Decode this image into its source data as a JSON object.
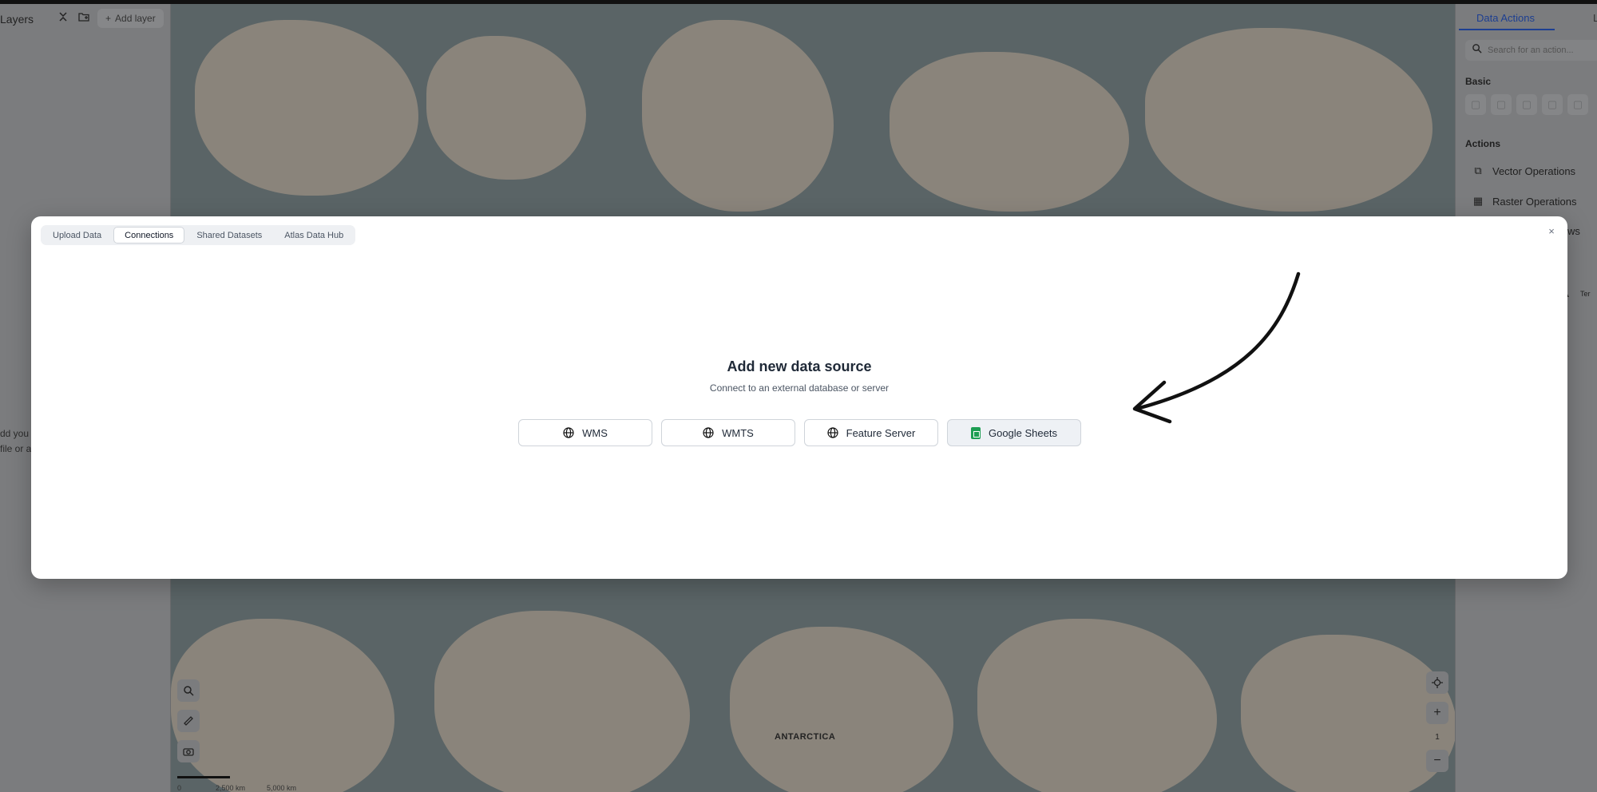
{
  "layers_panel": {
    "title": "Layers",
    "add_layer_label": "Add layer",
    "empty_hint_line1": "dd you",
    "empty_hint_line2": "file or a"
  },
  "map": {
    "label_antarctica": "ANTARCTICA",
    "scale_labels": [
      "0",
      "2,500 km",
      "5,000 km"
    ],
    "zoom_level": "1"
  },
  "actions_panel": {
    "tab_active": "Data Actions",
    "tab_other": "L",
    "search_placeholder": "Search for an action...",
    "section_basic": "Basic",
    "section_actions": "Actions",
    "items": [
      {
        "label": "Vector Operations"
      },
      {
        "label": "Raster Operations"
      },
      {
        "label": "ws"
      },
      {
        "label": "Ter"
      }
    ]
  },
  "modal": {
    "tabs": [
      {
        "label": "Upload Data",
        "active": false
      },
      {
        "label": "Connections",
        "active": true
      },
      {
        "label": "Shared Datasets",
        "active": false
      },
      {
        "label": "Atlas Data Hub",
        "active": false
      }
    ],
    "close_glyph": "×",
    "heading": "Add new data source",
    "subheading": "Connect to an external database or server",
    "sources": [
      {
        "label": "WMS",
        "icon": "globe-icon"
      },
      {
        "label": "WMTS",
        "icon": "globe-icon"
      },
      {
        "label": "Feature Server",
        "icon": "globe-icon"
      },
      {
        "label": "Google Sheets",
        "icon": "google-sheets-icon"
      }
    ]
  }
}
